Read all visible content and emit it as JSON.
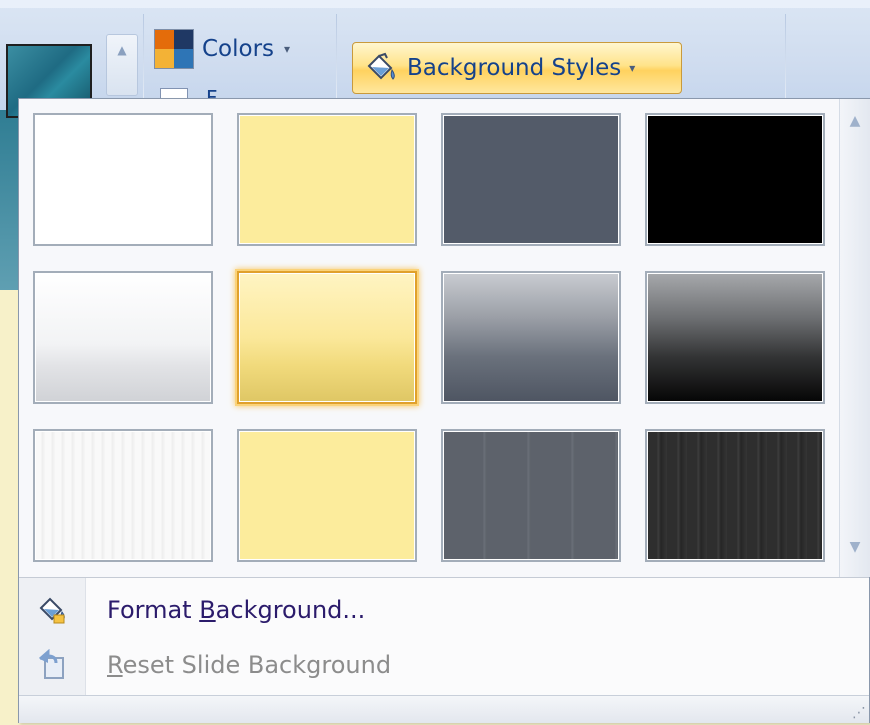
{
  "ribbon": {
    "colors_label": "Colors",
    "colors_caret": "▾",
    "fonts_peek_label": "F",
    "background_styles_label": "Background Styles",
    "background_styles_caret": "▾",
    "icon_colors": "color-scheme-icon",
    "icon_bucket": "paint-bucket-icon",
    "accent_button": "#ffd25f",
    "text_color": "#15428b"
  },
  "gallery": {
    "tiles": [
      {
        "id": "style-1",
        "fill": "#ffffff",
        "pattern": "solid",
        "selected": false
      },
      {
        "id": "style-2",
        "fill": "#fcec9c",
        "pattern": "solid",
        "selected": false
      },
      {
        "id": "style-3",
        "fill": "#535b69",
        "pattern": "solid",
        "selected": false
      },
      {
        "id": "style-4",
        "fill": "#000000",
        "pattern": "solid",
        "selected": false
      },
      {
        "id": "style-5",
        "fill": "#f5f6f8",
        "pattern": "gradient-light",
        "selected": false
      },
      {
        "id": "style-6",
        "fill": "#fbe89a",
        "pattern": "gradient-yellow",
        "selected": true
      },
      {
        "id": "style-7",
        "fill": "#7b8189",
        "pattern": "gradient-gray",
        "selected": false
      },
      {
        "id": "style-8",
        "fill": "#3a3a3a",
        "pattern": "gradient-dark",
        "selected": false
      },
      {
        "id": "style-9",
        "fill": "#f7f7f7",
        "pattern": "texture-light",
        "selected": false
      },
      {
        "id": "style-10",
        "fill": "#fcec9c",
        "pattern": "solid",
        "selected": false
      },
      {
        "id": "style-11",
        "fill": "#5b6068",
        "pattern": "texture-gray",
        "selected": false
      },
      {
        "id": "style-12",
        "fill": "#2e2e2e",
        "pattern": "texture-dark",
        "selected": false
      }
    ],
    "scroll_up": "▲",
    "scroll_down": "▼"
  },
  "menu": {
    "format_background": {
      "pre": "Format ",
      "accel": "B",
      "post": "ackground..."
    },
    "reset_background": {
      "accel": "R",
      "post": "eset Slide Background"
    },
    "resize_grip": "⋰"
  }
}
